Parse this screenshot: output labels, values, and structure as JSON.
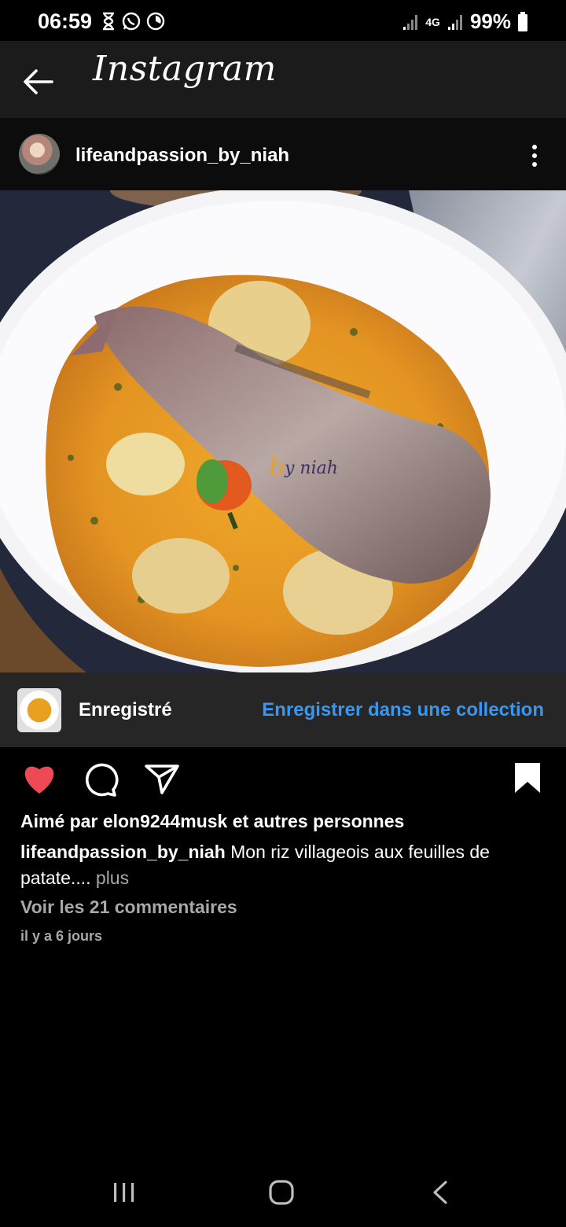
{
  "status_bar": {
    "time": "06:59",
    "battery": "99%",
    "network": "4G",
    "icons": [
      "hourglass-icon",
      "whatsapp-icon",
      "data-saver-icon",
      "signal-icon",
      "battery-icon"
    ]
  },
  "app_bar": {
    "title": "Instagram"
  },
  "post": {
    "username": "lifeandpassion_by_niah",
    "image_watermark": "by niah",
    "saved_label": "Enregistré",
    "save_to_collection": "Enregistrer dans une collection",
    "liked_by": "Aimé par elon9244musk et autres personnes",
    "caption_user": "lifeandpassion_by_niah",
    "caption_text": " Mon riz villageois aux feuilles de patate....",
    "caption_more": " plus",
    "view_comments": "Voir les 21 commentaires",
    "timestamp": "il y a 6 jours",
    "liked": true,
    "saved": true
  },
  "colors": {
    "like_red": "#ed4956",
    "link_blue": "#3897f0",
    "muted_text": "#a8a8a8",
    "app_bar_bg": "#1b1b1b",
    "saved_row_bg": "#262626"
  }
}
